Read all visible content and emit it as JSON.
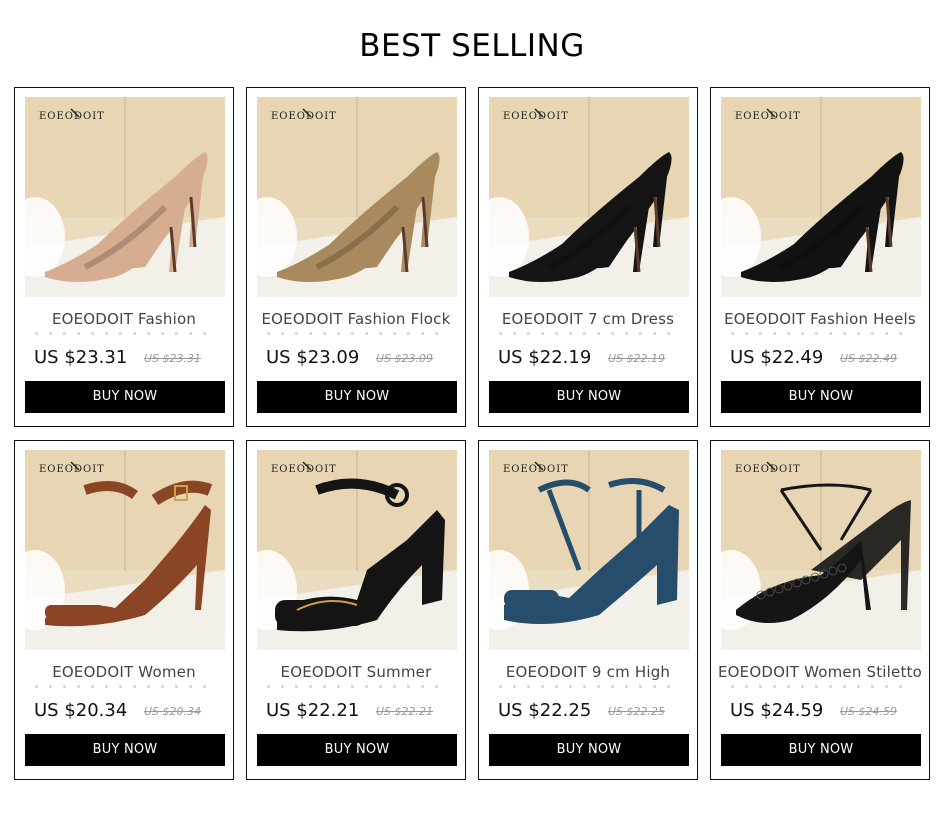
{
  "section_title": "BEST SELLING",
  "brand_watermark": "EOEODOIT",
  "products": [
    {
      "name": "EOEODOIT Fashion",
      "price": "US $23.31",
      "old_price": "US $23.31",
      "button": "BUY NOW",
      "shoe_color": "#d7ad92",
      "style": "pump"
    },
    {
      "name": "EOEODOIT Fashion Flock",
      "price": "US $23.09",
      "old_price": "US $23.09",
      "button": "BUY NOW",
      "shoe_color": "#a98a5f",
      "style": "pump"
    },
    {
      "name": "EOEODOIT 7 cm Dress",
      "price": "US $22.19",
      "old_price": "US $22.19",
      "button": "BUY NOW",
      "shoe_color": "#141414",
      "style": "pump"
    },
    {
      "name": "EOEODOIT Fashion Heels",
      "price": "US $22.49",
      "old_price": "US $22.49",
      "button": "BUY NOW",
      "shoe_color": "#121212",
      "style": "pump"
    },
    {
      "name": "EOEODOIT Women",
      "price": "US $20.34",
      "old_price": "US $20.34",
      "button": "BUY NOW",
      "shoe_color": "#8a4524",
      "style": "sandal"
    },
    {
      "name": "EOEODOIT Summer",
      "price": "US $22.21",
      "old_price": "US $22.21",
      "button": "BUY NOW",
      "shoe_color": "#141414",
      "style": "platform"
    },
    {
      "name": "EOEODOIT 9 cm High",
      "price": "US $22.25",
      "old_price": "US $22.25",
      "button": "BUY NOW",
      "shoe_color": "#264d6b",
      "style": "block"
    },
    {
      "name": "EOEODOIT Women Stiletto",
      "price": "US $24.59",
      "old_price": "US $24.59",
      "button": "BUY NOW",
      "shoe_color": "#151515",
      "style": "lace"
    }
  ]
}
